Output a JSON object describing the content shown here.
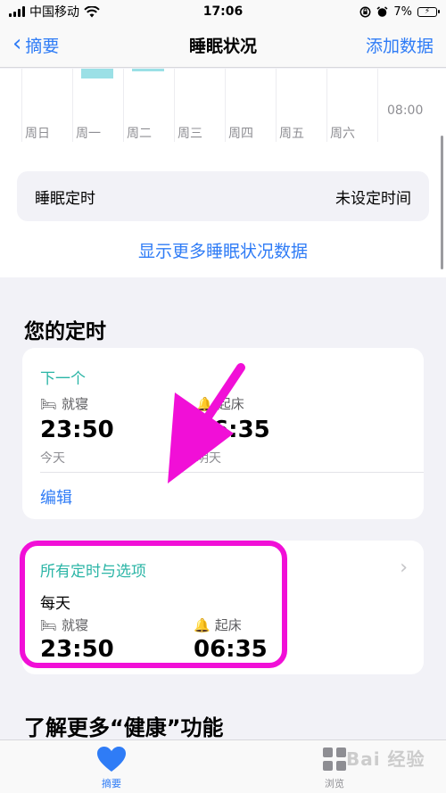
{
  "status_bar": {
    "carrier": "中国移动",
    "time": "17:06",
    "battery_text": "7%"
  },
  "nav": {
    "back_label": "摘要",
    "title": "睡眠状况",
    "action_label": "添加数据"
  },
  "chart": {
    "days": [
      "周日",
      "周一",
      "周二",
      "周三",
      "周四",
      "周五",
      "周六"
    ],
    "axis_label": "08:00",
    "bar_color": "#9be0e6"
  },
  "sleep_timer": {
    "label": "睡眠定时",
    "value": "未设定时间"
  },
  "show_more_label": "显示更多睡眠状况数据",
  "your_schedule": {
    "heading": "您的定时",
    "next_card": {
      "title": "下一个",
      "bedtime_label": "就寝",
      "bedtime_time": "23:50",
      "bedtime_day": "今天",
      "wake_label": "起床",
      "wake_time": "06:35",
      "wake_day": "明天",
      "edit_label": "编辑"
    },
    "all_card": {
      "title": "所有定时与选项",
      "frequency": "每天",
      "bedtime_label": "就寝",
      "bedtime_time": "23:50",
      "wake_label": "起床",
      "wake_time": "06:35"
    }
  },
  "learn_more_heading": "了解更多“健康”功能",
  "tabs": [
    {
      "label": "摘要",
      "icon": "heart-icon",
      "active": true
    },
    {
      "label": "浏览",
      "icon": "grid-icon",
      "active": false
    }
  ],
  "watermark": "Bai 经验",
  "colors": {
    "accent_blue": "#2f7cf6",
    "teal": "#2bb5a6",
    "annotation_magenta": "#f10fd7"
  }
}
